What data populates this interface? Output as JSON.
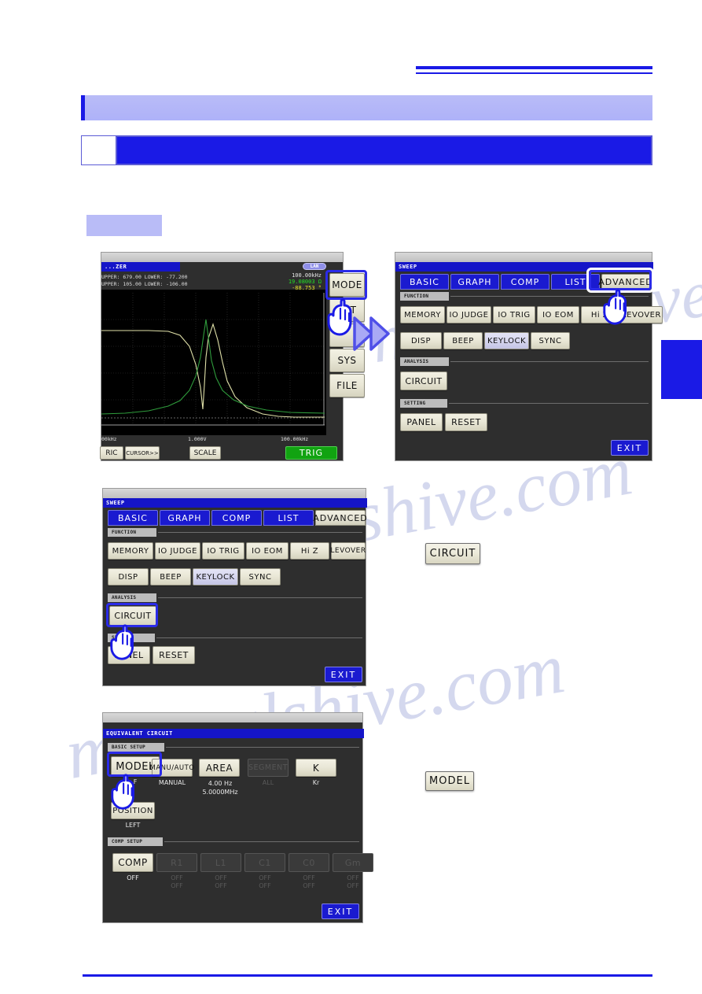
{
  "document": {
    "chapter_band_text": "",
    "section_number": "",
    "section_title": "",
    "step_label": "",
    "page_marker": "",
    "watermark": "manualshive.com"
  },
  "screen1": {
    "title": "...ZER",
    "status_pill": "LAN",
    "readout": {
      "frequency": "100.00kHz",
      "impedance": "19.08003 Ω",
      "phase": "-88.753  °"
    },
    "limits": [
      "UPPER:  679.00   LOWER: -77.200",
      "UPPER:  105.00   LOWER: -106.00"
    ],
    "axis": {
      "left": "00kHz",
      "center": "1.000V",
      "right": "100.00kHz"
    },
    "side_keys": [
      "MODE",
      "SET",
      "",
      "SYS",
      "FILE"
    ],
    "highlighted_key": "SET",
    "soft_keys": [
      "RIC",
      "CURSOR>>",
      "SCALE"
    ],
    "trig_label": "TRIG"
  },
  "screen2": {
    "title": "SWEEP",
    "tabs": [
      "BASIC",
      "GRAPH",
      "COMP",
      "LIST",
      "ADVANCED"
    ],
    "active_tab": "ADVANCED",
    "groups": [
      {
        "tag": "FUNCTION",
        "row1": [
          "MEMORY",
          "IO JUDGE",
          "IO TRIG",
          "IO EOM",
          "Hi Z",
          "LEVOVER"
        ],
        "row2": [
          "DISP",
          "BEEP",
          "KEYLOCK",
          "SYNC"
        ]
      },
      {
        "tag": "ANALYSIS",
        "row1": [
          "CIRCUIT"
        ]
      },
      {
        "tag": "SETTING",
        "row1": [
          "PANEL",
          "RESET"
        ]
      }
    ],
    "exit_label": "EXIT"
  },
  "screen3": {
    "title": "SWEEP",
    "tabs": [
      "BASIC",
      "GRAPH",
      "COMP",
      "LIST",
      "ADVANCED"
    ],
    "active_tab": "ADVANCED",
    "groups": [
      {
        "tag": "FUNCTION",
        "row1": [
          "MEMORY",
          "IO JUDGE",
          "IO TRIG",
          "IO EOM",
          "Hi Z",
          "LEVOVER"
        ],
        "row2": [
          "DISP",
          "BEEP",
          "KEYLOCK",
          "SYNC"
        ]
      },
      {
        "tag": "ANALYSIS",
        "row1": [
          "CIRCUIT"
        ]
      },
      {
        "tag": "SETTING",
        "row1": [
          "PANEL",
          "RESET"
        ]
      }
    ],
    "exit_label": "EXIT"
  },
  "screen4": {
    "title": "EQUIVALENT CIRCUIT",
    "basic_setup_tag": "BASIC SETUP",
    "comp_setup_tag": "COMP SETUP",
    "basic_keys": [
      {
        "label": "MODEL",
        "value": "F",
        "disabled": false
      },
      {
        "label": "MANU/AUTO",
        "value": "MANUAL",
        "disabled": false
      },
      {
        "label": "AREA",
        "value": "4.00 Hz\n5.0000MHz",
        "disabled": false
      },
      {
        "label": "SEGMENT",
        "value": "ALL",
        "disabled": true
      },
      {
        "label": "K",
        "value": "Kr",
        "disabled": false
      }
    ],
    "position_key": {
      "label": "POSITION",
      "value": "LEFT"
    },
    "comp_keys": [
      {
        "label": "COMP",
        "value": "OFF",
        "disabled": false
      },
      {
        "label": "R1",
        "value": "OFF\nOFF",
        "disabled": true
      },
      {
        "label": "L1",
        "value": "OFF\nOFF",
        "disabled": true
      },
      {
        "label": "C1",
        "value": "OFF\nOFF",
        "disabled": true
      },
      {
        "label": "C0",
        "value": "OFF\nOFF",
        "disabled": true
      },
      {
        "label": "Gm",
        "value": "OFF\nOFF",
        "disabled": true
      }
    ],
    "exit_label": "EXIT"
  },
  "callouts": {
    "circuit": "CIRCUIT",
    "model": "MODEL"
  }
}
